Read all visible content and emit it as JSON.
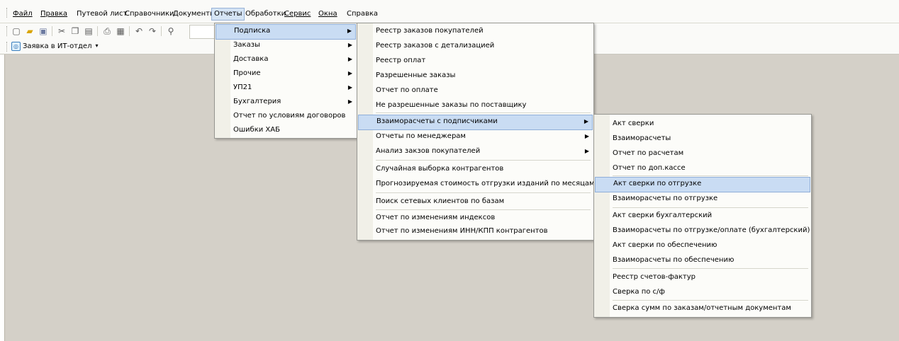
{
  "menubar": {
    "items": [
      "Файл",
      "Правка",
      "Путевой лист",
      "Справочники",
      "Документы",
      "Отчеты",
      "Обработки",
      "Сервис",
      "Окна",
      "Справка"
    ],
    "active": "Отчеты"
  },
  "toolbar": {
    "buttons": [
      "new-document-icon",
      "open-folder-icon",
      "save-icon",
      "cut-icon",
      "copy-icon",
      "paste-icon",
      "print-icon",
      "print-preview-icon",
      "undo-icon",
      "redo-icon",
      "search-icon"
    ],
    "search_value": ""
  },
  "toolbar2": {
    "ticket_label": "Заявка в ИТ-отдел"
  },
  "menu_reports": {
    "items": [
      {
        "label": "Подписка",
        "submenu": true
      },
      {
        "label": "Заказы",
        "submenu": true
      },
      {
        "label": "Доставка",
        "submenu": true
      },
      {
        "label": "Прочие",
        "submenu": true
      },
      {
        "label": "УП21",
        "submenu": true
      },
      {
        "label": "Бухгалтерия",
        "submenu": true
      },
      {
        "label": "Отчет по условиям договоров",
        "submenu": false
      },
      {
        "label": "Ошибки ХАБ",
        "submenu": false
      }
    ]
  },
  "menu_subscription": {
    "items": [
      {
        "label": "Реестр заказов покупателей"
      },
      {
        "label": "Реестр заказов с детализацией"
      },
      {
        "label": "Реестр оплат"
      },
      {
        "label": "Разрешенные заказы"
      },
      {
        "label": "Отчет по оплате"
      },
      {
        "label": "Не разрешенные заказы по поставщику"
      },
      {
        "label": "Взаиморасчеты с подписчиками",
        "submenu": true
      },
      {
        "label": "Отчеты по менеджерам",
        "submenu": true
      },
      {
        "label": "Анализ закзов покупателей",
        "submenu": true
      },
      {
        "label": "Случайная выборка контрагентов"
      },
      {
        "label": "Прогнозируемая стоимость отгрузки изданий по месяцам"
      },
      {
        "label": "Поиск сетевых клиентов по базам"
      },
      {
        "label": "Отчет по изменениям индексов"
      },
      {
        "label": "Отчет по изменениям ИНН/КПП контрагентов"
      }
    ]
  },
  "menu_settlements": {
    "items": [
      {
        "label": "Акт сверки"
      },
      {
        "label": "Взаиморасчеты"
      },
      {
        "label": "Отчет по расчетам"
      },
      {
        "label": "Отчет по доп.кассе"
      },
      {
        "label": "Акт сверки по отгрузке"
      },
      {
        "label": "Взаиморасчеты по отгрузке"
      },
      {
        "label": "Акт сверки бухгалтерский"
      },
      {
        "label": "Взаиморасчеты по отгрузке/оплате (бухгалтерский)"
      },
      {
        "label": "Акт сверки по обеспечению"
      },
      {
        "label": "Взаиморасчеты по обеспечению"
      },
      {
        "label": "Реестр счетов-фактур"
      },
      {
        "label": "Сверка по с/ф"
      },
      {
        "label": "Сверка сумм по заказам/отчетным документам"
      }
    ]
  }
}
